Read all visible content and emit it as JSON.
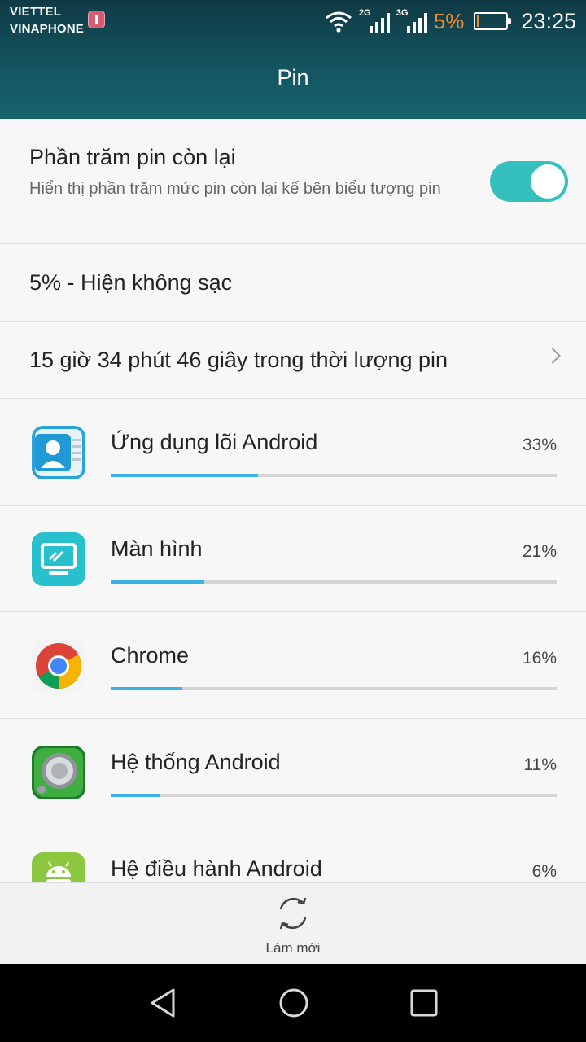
{
  "status_bar": {
    "carrier_1": "VIETTEL",
    "carrier_2": "VINAPHONE",
    "net_1": "2G",
    "net_2": "3G",
    "battery_percent": "5%",
    "time": "23:25",
    "battery_level": 0.05,
    "colors": {
      "battery_low": "#f08a2a"
    }
  },
  "header": {
    "title": "Pin"
  },
  "battery_percent_setting": {
    "title": "Phần trăm pin còn lại",
    "description": "Hiển thị phần trăm mức pin còn lại kế bên biểu tượng pin",
    "enabled": true
  },
  "charge_status": "5% - Hiện không sạc",
  "battery_duration": "15 giờ 34 phút 46 giây trong thời lượng pin",
  "apps": [
    {
      "name": "Ứng dụng lõi Android",
      "percent_label": "33%",
      "usage": 0.33,
      "icon": "contacts-icon"
    },
    {
      "name": "Màn hình",
      "percent_label": "21%",
      "usage": 0.21,
      "icon": "screen-icon"
    },
    {
      "name": "Chrome",
      "percent_label": "16%",
      "usage": 0.16,
      "icon": "chrome-icon"
    },
    {
      "name": "Hệ thống Android",
      "percent_label": "11%",
      "usage": 0.11,
      "icon": "android-system-icon"
    },
    {
      "name": "Hệ điều hành Android",
      "percent_label": "6%",
      "usage": 0.06,
      "icon": "android-robot-icon"
    }
  ],
  "bottom_bar": {
    "refresh_label": "Làm mới"
  },
  "colors": {
    "accent": "#35bfbf",
    "usage_bar": "#3cb3e6",
    "header": "#145661"
  }
}
